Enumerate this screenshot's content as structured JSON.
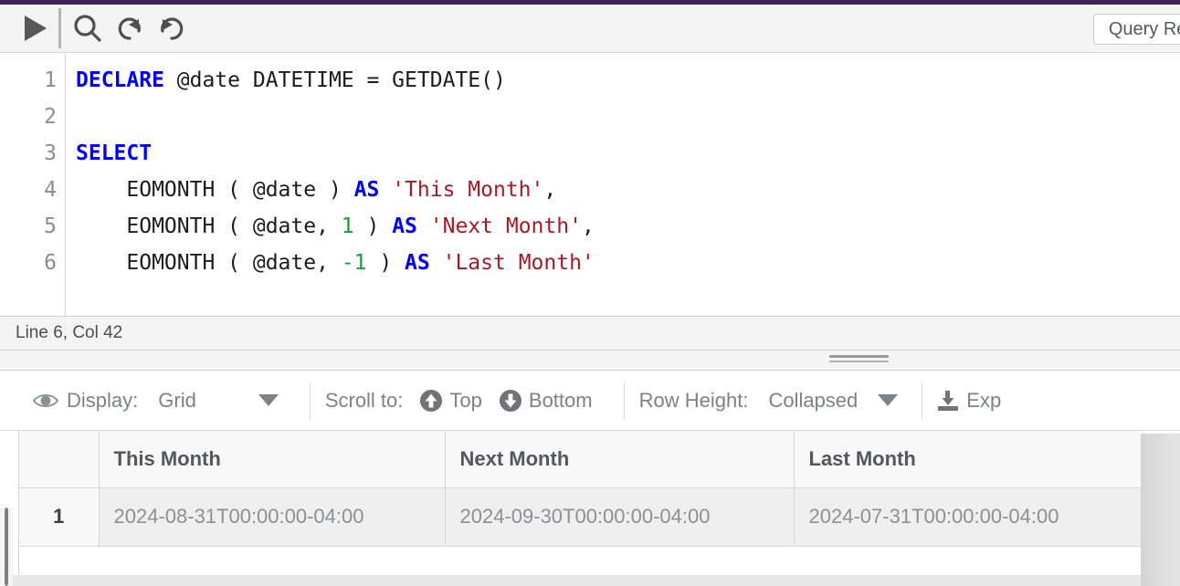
{
  "theme": {
    "accent_bar": "#3f2158",
    "keyword_color": "#0000f5",
    "string_color": "#a01d28",
    "number_color": "#1a9a42"
  },
  "toolbar": {
    "run_button": {
      "label": "Run",
      "icon": "play-icon"
    },
    "search_button": {
      "label": "Search",
      "icon": "search-icon"
    },
    "undo_button": {
      "label": "Undo",
      "icon": "undo-icon"
    },
    "redo_button": {
      "label": "Redo",
      "icon": "redo-icon"
    },
    "results_tab": {
      "label": "Query Results (Appr"
    }
  },
  "editor": {
    "line_numbers": [
      "1",
      "2",
      "3",
      "4",
      "5",
      "6"
    ],
    "lines": [
      {
        "n": "1",
        "tokens": [
          {
            "t": "DECLARE",
            "c": "kw"
          },
          {
            "t": " @date DATETIME = GETDATE()",
            "c": ""
          }
        ]
      },
      {
        "n": "2",
        "tokens": [
          {
            "t": "",
            "c": ""
          }
        ]
      },
      {
        "n": "3",
        "tokens": [
          {
            "t": "SELECT",
            "c": "kw"
          }
        ]
      },
      {
        "n": "4",
        "tokens": [
          {
            "t": "    EOMONTH ( @date ) ",
            "c": ""
          },
          {
            "t": "AS",
            "c": "kw"
          },
          {
            "t": " ",
            "c": ""
          },
          {
            "t": "'This Month'",
            "c": "str"
          },
          {
            "t": ",",
            "c": ""
          }
        ]
      },
      {
        "n": "5",
        "tokens": [
          {
            "t": "    EOMONTH ( @date, ",
            "c": ""
          },
          {
            "t": "1",
            "c": "num"
          },
          {
            "t": " ) ",
            "c": ""
          },
          {
            "t": "AS",
            "c": "kw"
          },
          {
            "t": " ",
            "c": ""
          },
          {
            "t": "'Next Month'",
            "c": "str"
          },
          {
            "t": ",",
            "c": ""
          }
        ]
      },
      {
        "n": "6",
        "tokens": [
          {
            "t": "    EOMONTH ( @date, ",
            "c": ""
          },
          {
            "t": "-1",
            "c": "num"
          },
          {
            "t": " ) ",
            "c": ""
          },
          {
            "t": "AS",
            "c": "kw"
          },
          {
            "t": " ",
            "c": ""
          },
          {
            "t": "'Last Month'",
            "c": "str"
          }
        ]
      }
    ]
  },
  "status": {
    "cursor_position": "Line 6, Col 42"
  },
  "results_toolbar": {
    "display_label": "Display:",
    "display_value": "Grid",
    "scroll_label": "Scroll to:",
    "scroll_top": "Top",
    "scroll_bottom": "Bottom",
    "row_height_label": "Row Height:",
    "row_height_value": "Collapsed",
    "export_label": "Exp"
  },
  "results_grid": {
    "columns": [
      "This Month",
      "Next Month",
      "Last Month"
    ],
    "rows": [
      {
        "index": "1",
        "cells": [
          "2024-08-31T00:00:00-04:00",
          "2024-09-30T00:00:00-04:00",
          "2024-07-31T00:00:00-04:00"
        ]
      }
    ]
  }
}
